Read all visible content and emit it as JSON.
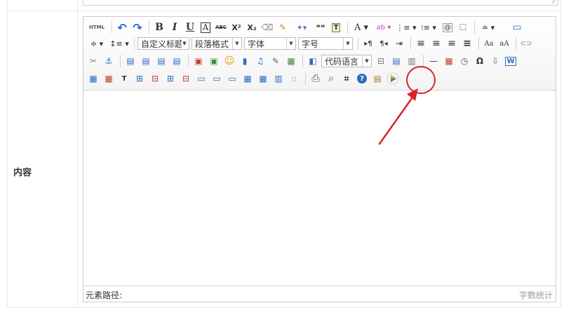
{
  "row": {
    "label": "内容"
  },
  "prev_row": {
    "grip": "//"
  },
  "toolbar": {
    "row1": {
      "source": "HTML",
      "undo": "↶",
      "redo": "↷",
      "bold": "B",
      "italic": "I",
      "underline": "U",
      "fontborder": "A",
      "strikethrough": "ABC",
      "superscript": "X²",
      "subscript": "X₂",
      "removeformat": "⌫",
      "formatmatch": "✎",
      "autotypeset": "✦▾",
      "blockquote": "❝❝",
      "pasteplain": "T",
      "forecolor": "A ▾",
      "backcolor": "ab ▾",
      "orderedlist": "⋮≡ ▾",
      "unorderedlist": "⁝≡ ▾",
      "selectall": "@",
      "cleardoc": "☐",
      "rowspacing": "≐ ▾",
      "preview": "▭"
    },
    "row2": {
      "paragraph_spacing": "≑ ▾",
      "lineheight": "↕≡ ▾",
      "custom_style": "自定义标题",
      "paragraph_format": "段落格式",
      "font_family": "字体",
      "font_size": "字号",
      "ltr": "▸¶",
      "rtl": "¶◂",
      "indent": "⇥",
      "justify_left": "≡",
      "justify_center": "≡",
      "justify_right": "≡",
      "justify_full": "≡",
      "touppercase": "Aa",
      "tolowercase": "aA",
      "link": "⊂⊃"
    },
    "row3": {
      "unlink": "✂",
      "anchor": "⚓",
      "img_none": "▤",
      "img_left": "▤",
      "img_right": "▤",
      "img_center": "▤",
      "simpleupload": "▣",
      "insertimage": "▣",
      "emotion": "☺",
      "scrawl": "▮",
      "music": "♫",
      "attachment": "✎",
      "map": "▦",
      "insertframe": "◧",
      "code_language": "代码语言",
      "pagebreak": "⊟",
      "template": "▤",
      "background": "▥",
      "horizontal": "—",
      "date": "▦",
      "time": "◷",
      "spechars": "Ω",
      "snapscreen": "⇩",
      "wordimage": "W"
    },
    "row4": {
      "inserttable": "▦",
      "deletetable": "▦",
      "insertparagraphbeforetable": "T",
      "insertrow": "⊞",
      "deleterow": "⊟",
      "insertcol": "⊞",
      "deletecol": "⊟",
      "mergecells": "▭",
      "mergeright": "▭",
      "mergedown": "▭",
      "splittocells": "▦",
      "splittorows": "▦",
      "splittocols": "▥",
      "charts": "▫",
      "print": "⎙",
      "searchreplace": "⌕",
      "drafts": "⌗",
      "help": "?",
      "paste": "▤",
      "play": "▶"
    }
  },
  "statusbar": {
    "path_label": "元素路径:",
    "word_count": "字数统计"
  },
  "colors": {
    "highlight": "#d9232d",
    "play_green": "#25a53a",
    "play_orange": "#f0a010",
    "play_blue": "#2a7ed0",
    "accent_blue": "#2b6dbf"
  }
}
